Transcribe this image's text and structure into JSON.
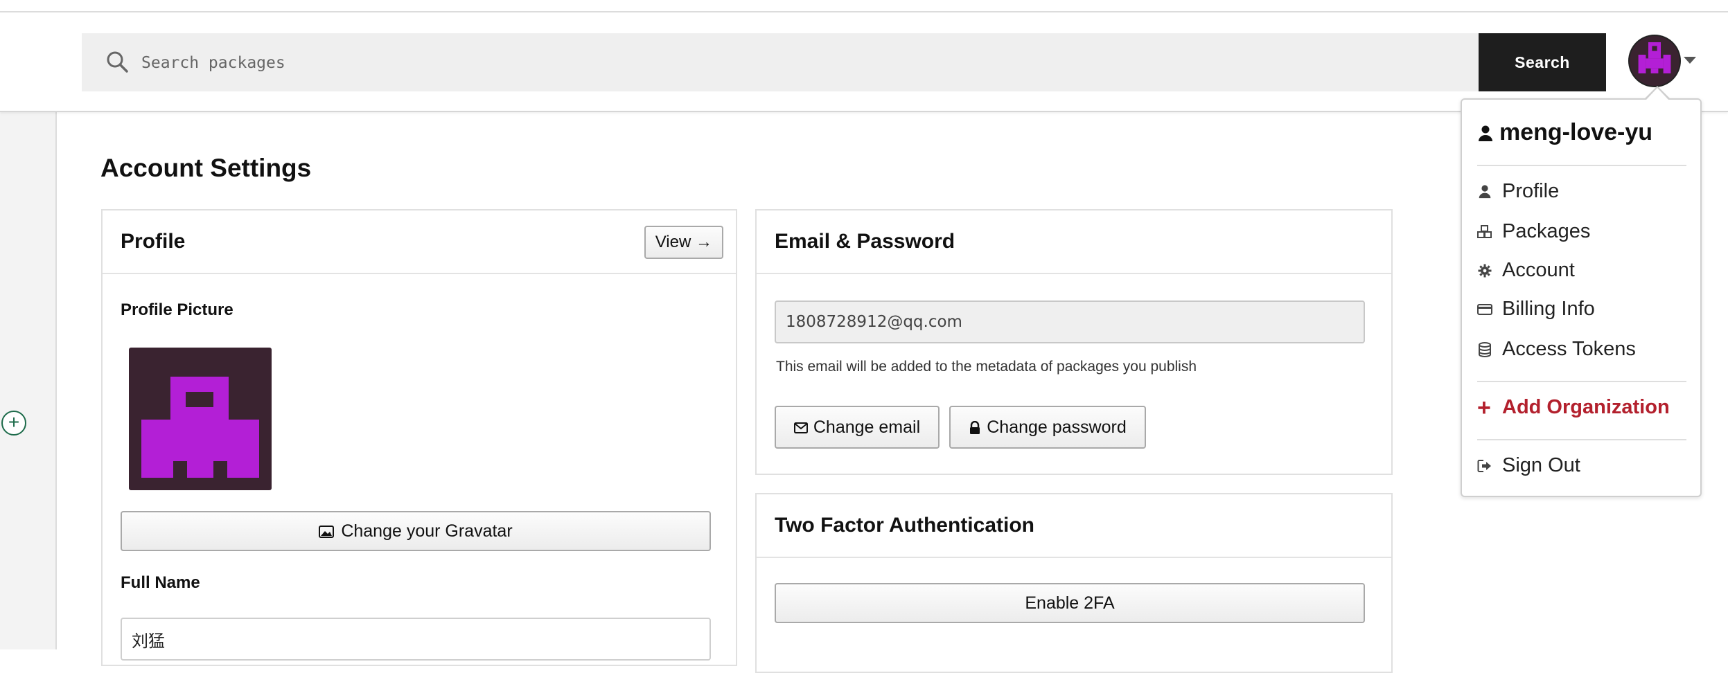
{
  "header": {
    "search_placeholder": "Search packages",
    "search_button": "Search"
  },
  "page": {
    "title": "Account Settings"
  },
  "profile_panel": {
    "title": "Profile",
    "view_button": "View →",
    "picture_label": "Profile Picture",
    "gravatar_button": "Change your Gravatar",
    "full_name_label": "Full Name",
    "full_name_value": "刘猛"
  },
  "email_panel": {
    "title": "Email & Password",
    "email_value": "1808728912@qq.com",
    "email_note": "This email will be added to the metadata of packages you publish",
    "change_email_button": "Change email",
    "change_password_button": "Change password"
  },
  "twofa_panel": {
    "title": "Two Factor Authentication",
    "enable_button": "Enable 2FA"
  },
  "user_menu": {
    "username": "meng-love-yu",
    "items": [
      {
        "label": "Profile",
        "icon": "user-icon"
      },
      {
        "label": "Packages",
        "icon": "packages-icon"
      },
      {
        "label": "Account",
        "icon": "gear-icon"
      },
      {
        "label": "Billing Info",
        "icon": "credit-card-icon"
      },
      {
        "label": "Access Tokens",
        "icon": "tokens-icon"
      }
    ],
    "add_organization": "Add Organization",
    "sign_out": "Sign Out"
  },
  "colors": {
    "avatar_bg": "#3a2330",
    "avatar_fg": "#b31fd6",
    "add_org": "#b3202d",
    "search_button_bg": "#1e1e1e"
  }
}
